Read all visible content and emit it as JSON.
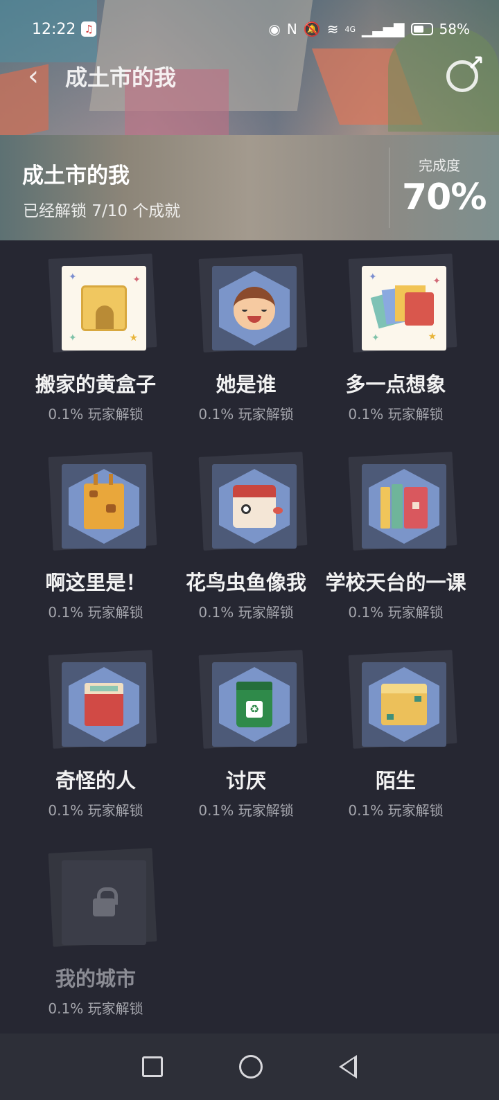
{
  "status_bar": {
    "time": "12:22",
    "network": "4G",
    "battery": "58%"
  },
  "header": {
    "title": "成土市的我",
    "back_icon": "chevron-left-icon",
    "share_icon": "share-icon"
  },
  "summary": {
    "title": "成土市的我",
    "subtitle": "已经解锁 7/10 个成就",
    "completion_label": "完成度",
    "completion_value": "70%",
    "completion_fraction": 0.7
  },
  "achievements": [
    {
      "name": "搬家的黄盒子",
      "rate": "0.1% 玩家解锁",
      "icon": "yellow-box-icon",
      "locked": false
    },
    {
      "name": "她是谁",
      "rate": "0.1% 玩家解锁",
      "icon": "girl-face-icon",
      "locked": false
    },
    {
      "name": "多一点想象",
      "rate": "0.1% 玩家解锁",
      "icon": "color-cubes-icon",
      "locked": false
    },
    {
      "name": "啊这里是！",
      "rate": "0.1% 玩家解锁",
      "icon": "giraffe-box-icon",
      "locked": false
    },
    {
      "name": "花鸟虫鱼像我",
      "rate": "0.1% 玩家解锁",
      "icon": "bird-box-icon",
      "locked": false
    },
    {
      "name": "学校天台的一课",
      "rate": "0.1% 玩家解锁",
      "icon": "books-icon",
      "locked": false
    },
    {
      "name": "奇怪的人",
      "rate": "0.1% 玩家解锁",
      "icon": "open-red-box-icon",
      "locked": false
    },
    {
      "name": "讨厌",
      "rate": "0.1% 玩家解锁",
      "icon": "trash-bin-icon",
      "locked": false
    },
    {
      "name": "陌生",
      "rate": "0.1% 玩家解锁",
      "icon": "cardboard-box-icon",
      "locked": false
    },
    {
      "name": "我的城市",
      "rate": "0.1% 玩家解锁",
      "icon": "lock-icon",
      "locked": true
    }
  ],
  "system_nav": {
    "recents_icon": "square-icon",
    "home_icon": "circle-icon",
    "back_icon": "triangle-back-icon"
  }
}
